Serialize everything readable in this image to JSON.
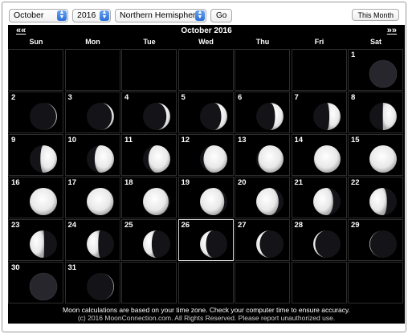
{
  "controls": {
    "month": "October",
    "year": "2016",
    "hemisphere": "Northern Hemisphere",
    "go_label": "Go",
    "this_month_label": "This Month"
  },
  "calendar": {
    "title": "October 2016",
    "prev_label": "««",
    "next_label": "»»",
    "weekdays": [
      "Sun",
      "Mon",
      "Tue",
      "Wed",
      "Thu",
      "Fri",
      "Sat"
    ],
    "first_weekday_index": 6,
    "today_day": 26,
    "days": [
      {
        "day": 1,
        "illumination": 0.0,
        "waxing": true
      },
      {
        "day": 2,
        "illumination": 0.03,
        "waxing": true
      },
      {
        "day": 3,
        "illumination": 0.08,
        "waxing": true
      },
      {
        "day": 4,
        "illumination": 0.14,
        "waxing": true
      },
      {
        "day": 5,
        "illumination": 0.22,
        "waxing": true
      },
      {
        "day": 6,
        "illumination": 0.31,
        "waxing": true
      },
      {
        "day": 7,
        "illumination": 0.41,
        "waxing": true
      },
      {
        "day": 8,
        "illumination": 0.51,
        "waxing": true
      },
      {
        "day": 9,
        "illumination": 0.61,
        "waxing": true
      },
      {
        "day": 10,
        "illumination": 0.71,
        "waxing": true
      },
      {
        "day": 11,
        "illumination": 0.8,
        "waxing": true
      },
      {
        "day": 12,
        "illumination": 0.87,
        "waxing": true
      },
      {
        "day": 13,
        "illumination": 0.93,
        "waxing": true
      },
      {
        "day": 14,
        "illumination": 0.97,
        "waxing": true
      },
      {
        "day": 15,
        "illumination": 1.0,
        "waxing": true
      },
      {
        "day": 16,
        "illumination": 1.0,
        "waxing": false
      },
      {
        "day": 17,
        "illumination": 0.98,
        "waxing": false
      },
      {
        "day": 18,
        "illumination": 0.94,
        "waxing": false
      },
      {
        "day": 19,
        "illumination": 0.89,
        "waxing": false
      },
      {
        "day": 20,
        "illumination": 0.82,
        "waxing": false
      },
      {
        "day": 21,
        "illumination": 0.73,
        "waxing": false
      },
      {
        "day": 22,
        "illumination": 0.64,
        "waxing": false
      },
      {
        "day": 23,
        "illumination": 0.53,
        "waxing": false
      },
      {
        "day": 24,
        "illumination": 0.42,
        "waxing": false
      },
      {
        "day": 25,
        "illumination": 0.32,
        "waxing": false
      },
      {
        "day": 26,
        "illumination": 0.22,
        "waxing": false
      },
      {
        "day": 27,
        "illumination": 0.13,
        "waxing": false
      },
      {
        "day": 28,
        "illumination": 0.07,
        "waxing": false
      },
      {
        "day": 29,
        "illumination": 0.02,
        "waxing": false
      },
      {
        "day": 30,
        "illumination": 0.0,
        "waxing": true
      },
      {
        "day": 31,
        "illumination": 0.02,
        "waxing": true
      }
    ]
  },
  "footer": {
    "line1": "Moon calculations are based on your time zone. Check your computer time to ensure accuracy.",
    "line2": "(c) 2016 MoonConnection.com. All Rights Reserved. Please report unauthorized use."
  },
  "colors": {
    "background": "#000000",
    "moon_lit": "#e8e8e8",
    "moon_dark": "#141418",
    "select_arrow": "#2a6fd8"
  }
}
